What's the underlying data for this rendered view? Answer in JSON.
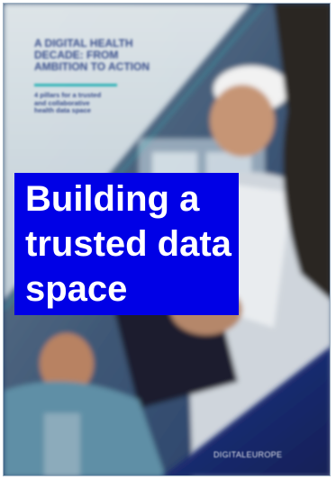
{
  "cover": {
    "title_lines": [
      "A DIGITAL HEALTH",
      "DECADE: FROM",
      "AMBITION TO ACTION"
    ],
    "subtitle_lines": [
      "4 pillars for a trusted",
      "and collaborative",
      "health data space"
    ],
    "publisher": "DIGITALEUROPE"
  },
  "headline": {
    "lines": [
      "Building a",
      "trusted data",
      "space"
    ]
  },
  "colors": {
    "headline_background": "#0000e6",
    "headline_text": "#ffffff",
    "cover_title": "#3a4f8c",
    "cover_accent": "#2fb3b7",
    "cover_dark": "#1c2a52"
  }
}
